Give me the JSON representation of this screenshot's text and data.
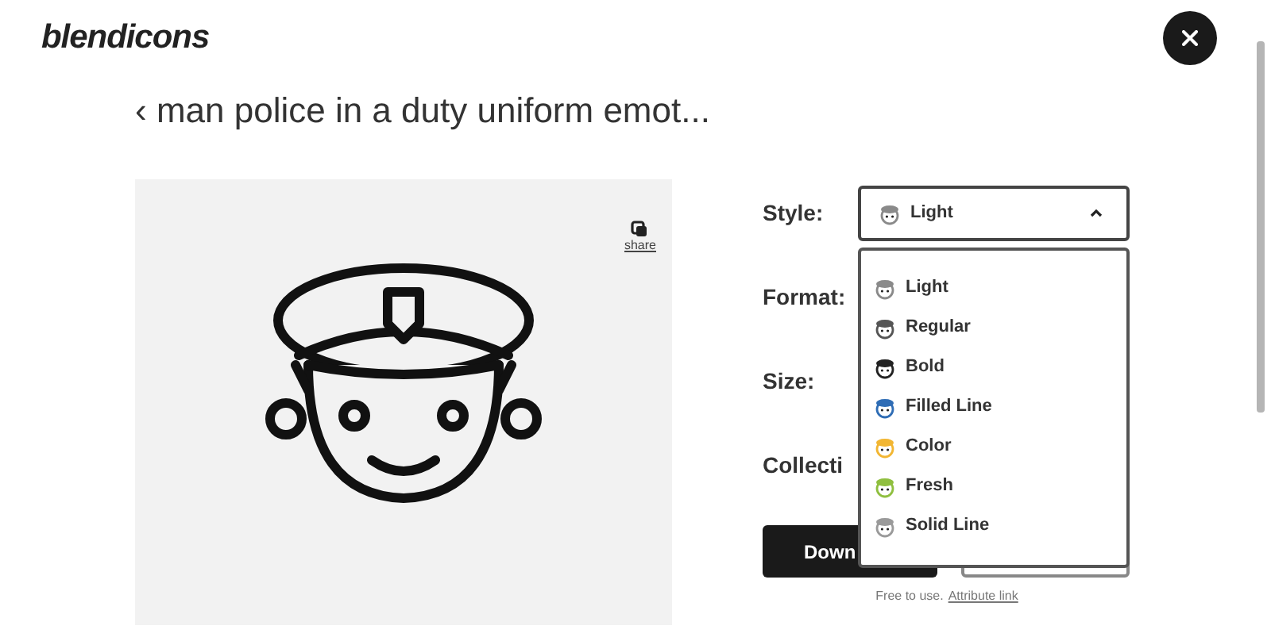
{
  "logo": "blendicons",
  "title": "‹ man police in a duty uniform emot...",
  "preview": {
    "share_label": "share"
  },
  "fields": [
    {
      "label": "Style:",
      "kind": "select",
      "value": "Light",
      "expanded": true
    },
    {
      "label": "Format:",
      "kind": "plain"
    },
    {
      "label": "Size:",
      "kind": "plain"
    },
    {
      "label": "Collecti",
      "kind": "plain"
    }
  ],
  "dropdown": [
    {
      "label": "Light",
      "color": "#8a8a8a"
    },
    {
      "label": "Regular",
      "color": "#555555"
    },
    {
      "label": "Bold",
      "color": "#222222"
    },
    {
      "label": "Filled Line",
      "color": "#2f6db5"
    },
    {
      "label": "Color",
      "color": "#f2b632"
    },
    {
      "label": "Fresh",
      "color": "#8fbf3f"
    },
    {
      "label": "Solid Line",
      "color": "#9a9a9a"
    }
  ],
  "download_button": "Down",
  "footer": {
    "text": "Free to use.",
    "link": "Attribute link"
  }
}
